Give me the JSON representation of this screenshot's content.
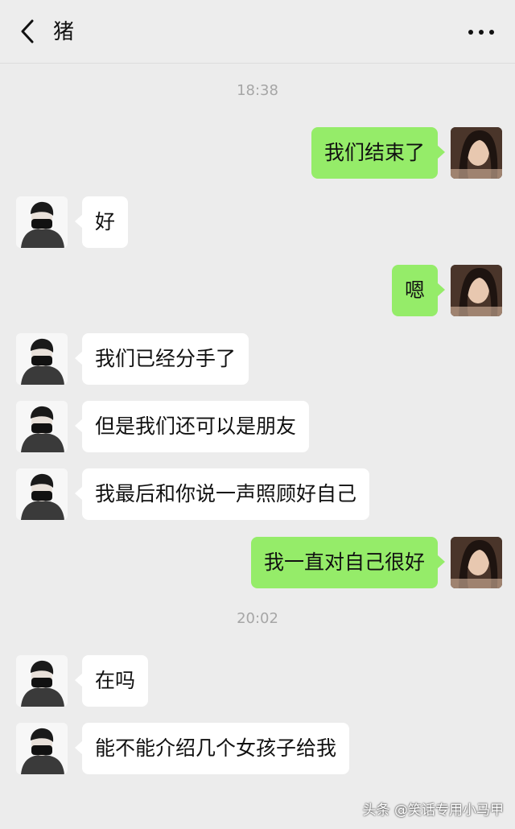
{
  "header": {
    "title": "猪",
    "back_icon": "chevron-left-icon",
    "more_icon": "more-dots-icon"
  },
  "timestamps": [
    "18:38",
    "20:02"
  ],
  "messages": [
    {
      "side": "right",
      "text": "我们结束了"
    },
    {
      "side": "left",
      "text": "好"
    },
    {
      "side": "right",
      "text": "嗯"
    },
    {
      "side": "left",
      "text": "我们已经分手了"
    },
    {
      "side": "left",
      "text": "但是我们还可以是朋友"
    },
    {
      "side": "left",
      "text": "我最后和你说一声照顾好自己"
    },
    {
      "side": "right",
      "text": "我一直对自己很好"
    },
    {
      "side": "left",
      "text": "在吗"
    },
    {
      "side": "left",
      "text": "能不能介绍几个女孩子给我"
    }
  ],
  "watermark": "头条 @笑话专用小马甲",
  "colors": {
    "sent_bubble": "#95ec69",
    "received_bubble": "#ffffff",
    "background": "#ececec"
  }
}
